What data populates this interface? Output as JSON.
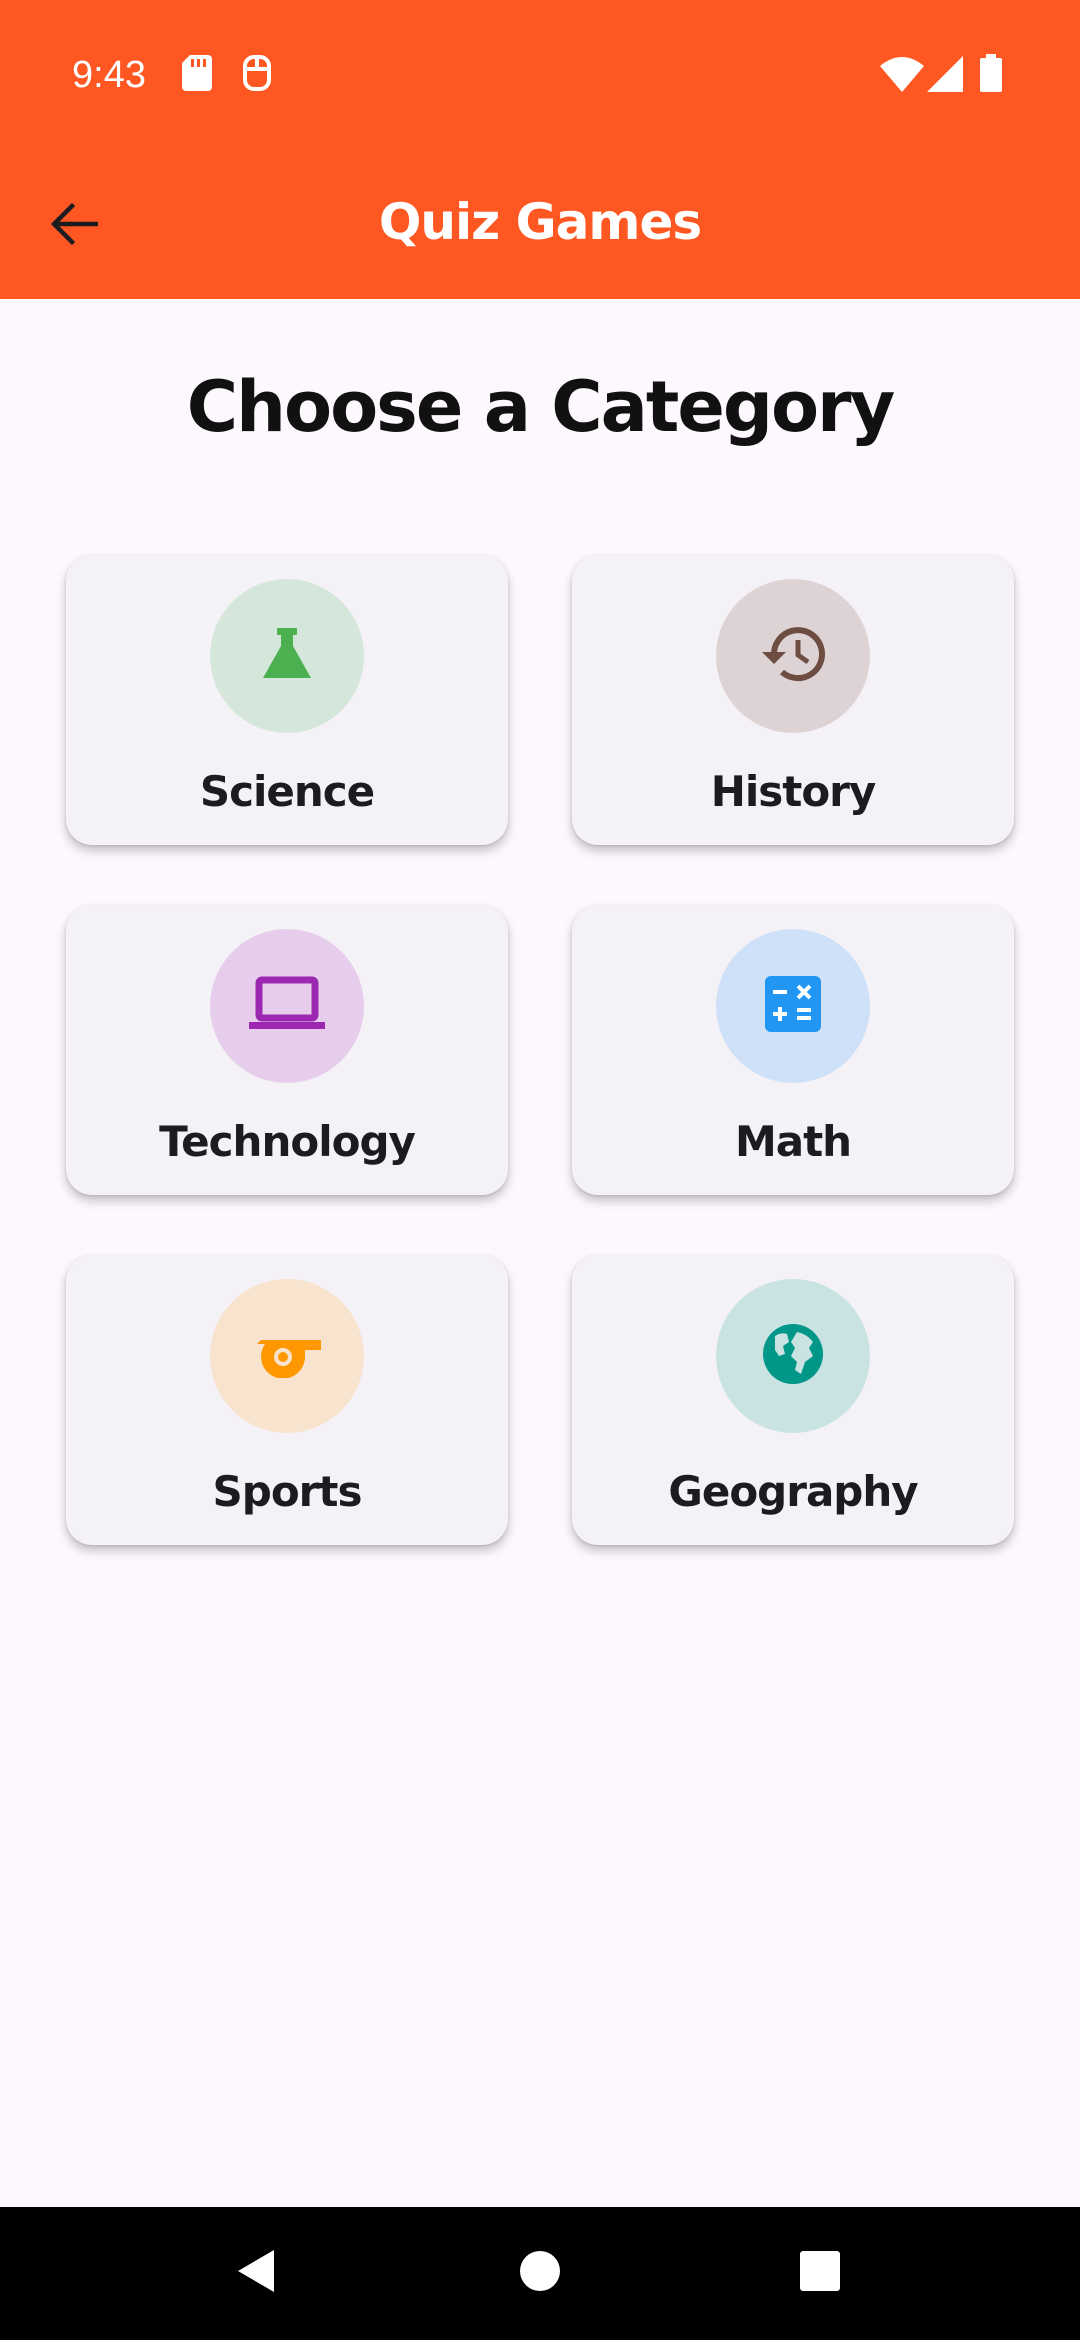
{
  "status_bar": {
    "time": "9:43",
    "left_icons": [
      "sd-card-icon",
      "notification-app-icon"
    ],
    "right_icons": [
      "wifi-icon",
      "cellular-signal-icon",
      "battery-icon"
    ]
  },
  "app_bar": {
    "title": "Quiz Games",
    "back_icon": "arrow-back-icon",
    "background_color": "#FF5722"
  },
  "heading": "Choose a Category",
  "categories": [
    {
      "label": "Science",
      "icon": "flask-icon",
      "icon_color": "#4CAF50",
      "circle_color": "#D4E7DA"
    },
    {
      "label": "History",
      "icon": "history-icon",
      "icon_color": "#6D4C41",
      "circle_color": "#DDD3D5"
    },
    {
      "label": "Technology",
      "icon": "laptop-icon",
      "icon_color": "#9C27B0",
      "circle_color": "#E6CDEB"
    },
    {
      "label": "Math",
      "icon": "calculator-icon",
      "icon_color": "#2196F3",
      "circle_color": "#CFE1F8"
    },
    {
      "label": "Sports",
      "icon": "whistle-icon",
      "icon_color": "#FF9800",
      "circle_color": "#F8E3CE"
    },
    {
      "label": "Geography",
      "icon": "globe-icon",
      "icon_color": "#009688",
      "circle_color": "#C9E3E2"
    }
  ],
  "nav_bar": {
    "back_icon": "nav-back-icon",
    "home_icon": "nav-home-icon",
    "recents_icon": "nav-recents-icon"
  }
}
